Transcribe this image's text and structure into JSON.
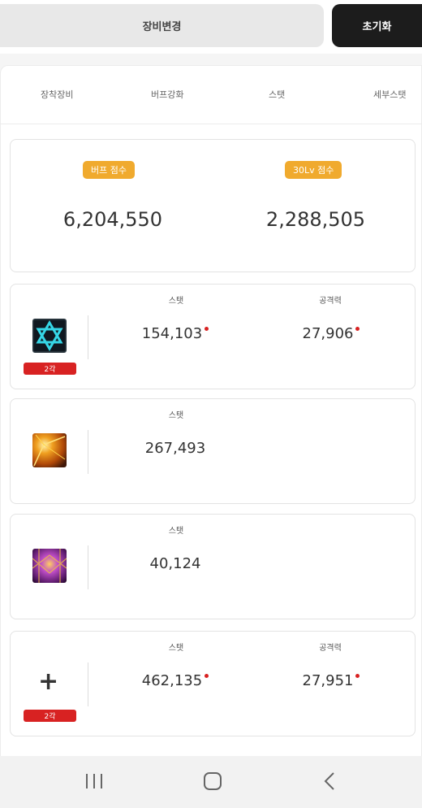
{
  "header": {
    "change_label": "장비변경",
    "reset_label": "초기화"
  },
  "tabs": [
    "장착장비",
    "버프강화",
    "스탯",
    "세부스탯"
  ],
  "scores": {
    "buff": {
      "label": "버프 점수",
      "value": "6,204,550"
    },
    "lv30": {
      "label": "30Lv 점수",
      "value": "2,288,505"
    }
  },
  "items": [
    {
      "icon": "hexagram-skill-icon",
      "tier": "2각",
      "stat_label": "스탯",
      "stat_value": "154,103",
      "atk_label": "공격력",
      "atk_value": "27,906"
    },
    {
      "icon": "golden-light-skill-icon",
      "stat_label": "스탯",
      "stat_value": "267,493"
    },
    {
      "icon": "purple-lattice-skill-icon",
      "stat_label": "스탯",
      "stat_value": "40,124"
    },
    {
      "icon": "plus-icon",
      "tier": "2각",
      "stat_label": "스탯",
      "stat_value": "462,135",
      "atk_label": "공격력",
      "atk_value": "27,951"
    }
  ],
  "accent_colors": {
    "badge": "#f0aa2e",
    "tier": "#d82222",
    "dark": "#1c1c1c"
  },
  "nav": [
    "recent-apps-icon",
    "home-icon",
    "back-icon"
  ]
}
